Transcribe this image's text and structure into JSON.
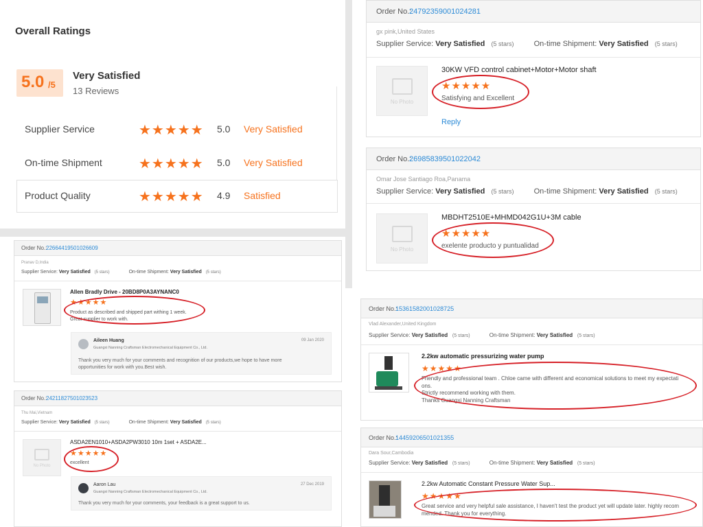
{
  "overall": {
    "title": "Overall Ratings",
    "score": "5.0",
    "score_max": "/5",
    "word": "Very Satisfied",
    "reviews": "13 Reviews",
    "rows": [
      {
        "label": "Supplier Service",
        "stars": "★★★★★",
        "value": "5.0",
        "word": "Very Satisfied"
      },
      {
        "label": "On-time Shipment",
        "stars": "★★★★★",
        "value": "5.0",
        "word": "Very Satisfied"
      },
      {
        "label": "Product Quality",
        "stars": "★★★★★",
        "value": "4.9",
        "word": "Satisfied"
      }
    ]
  },
  "common": {
    "order_label": "Order No.:",
    "supplier_service": "Supplier Service:",
    "ontime_shipment": "On-time Shipment:",
    "very_satisfied": "Very Satisfied",
    "five_stars": "(5 stars)",
    "stars": "★★★★★",
    "no_photo": "No Photo",
    "reply": "Reply",
    "company": "Guangxi Nanning Craftsman Electromechanical Equipment Co., Ltd."
  },
  "reviews": [
    {
      "order": "24792359001024281",
      "buyer": "gx pink,United States",
      "product": "30KW VFD control cabinet+Motor+Motor shaft",
      "text": "Satisfying and Excellent"
    },
    {
      "order": "26985839501022042",
      "buyer": "Omar Jose Santiago Roa,Panama",
      "product": "MBDHT2510E+MHMD042G1U+3M cable",
      "text": "exelente producto y puntualidad"
    },
    {
      "order": "22664419501026609",
      "buyer": "Pranav D,India",
      "product": "Allen Bradly Drive - 20BD8P0A3AYNANC0",
      "text_lines": [
        "Product as described and shipped part withing 1 week.",
        "Great supplier to work with."
      ],
      "responder": "Aileen Huang",
      "date": "09 Jan 2020",
      "response_lines": [
        "Thank you very much for your comments and recognition of our products,we hope to have more",
        "opportunities for work with you.Best wish."
      ]
    },
    {
      "order": "24211827501023523",
      "buyer": "Thu Mai,Vietnam",
      "product": "ASDA2EN1010+ASDA2PW3010  10m 1set + ASDA2E...",
      "text": "excellent",
      "responder": "Aaron Lau",
      "date": "27 Dec 2019",
      "response": "Thank you very much for your comments,   your feedback is a great support to us."
    },
    {
      "order": "15361582001028725",
      "buyer": "Vlad Alexander,United Kingdom",
      "product": "2.2kw automatic pressurizing water pump",
      "text_lines": [
        "Friendly and professional team . Chloe came with different and economical solutions to meet my expectati",
        "ons.",
        "Strictly recommend working with them.",
        "Thanks Guangxi Nanning Craftsman"
      ]
    },
    {
      "order": "14459206501021355",
      "buyer": "Dara Sour,Cambodia",
      "product": "2.2kw Automatic Constant Pressure Water Sup...",
      "text_lines": [
        "Great service and very helpful sale assistance, I haven't test the product yet will update later. highly recom",
        "mended. Thank you for everything."
      ]
    }
  ]
}
